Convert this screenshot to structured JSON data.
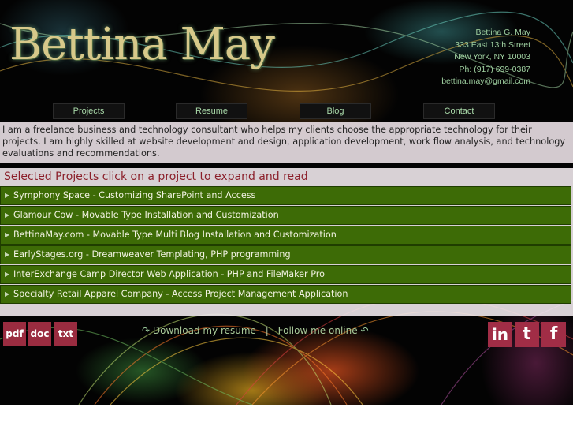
{
  "header": {
    "logo_text": "Bettina May",
    "contact": {
      "name": "Bettina G. May",
      "street": "333 East 13th Street",
      "city": "New York, NY 10003",
      "phone": "Ph: (917) 699-0387",
      "email": "bettina.may@gmail.com"
    }
  },
  "nav": {
    "items": [
      {
        "label": "Projects"
      },
      {
        "label": "Resume"
      },
      {
        "label": "Blog"
      },
      {
        "label": "Contact"
      }
    ]
  },
  "intro": {
    "text": "I am a freelance business and technology consultant who helps my clients choose the appropriate technology for their projects. I am highly skilled at website development and design, application development, work flow analysis, and technology evaluations and recommendations."
  },
  "projects": {
    "title": "Selected Projects click on a project to expand and read",
    "items": [
      {
        "label": "Symphony Space - Customizing SharePoint and Access"
      },
      {
        "label": "Glamour Cow - Movable Type Installation and Customization"
      },
      {
        "label": "BettinaMay.com - Movable Type Multi Blog Installation and Customization"
      },
      {
        "label": "EarlyStages.org - Dreamweaver Templating, PHP programming"
      },
      {
        "label": "InterExchange Camp Director Web Application - PHP and FileMaker Pro"
      },
      {
        "label": "Specialty Retail Apparel Company - Access Project Management Application"
      }
    ]
  },
  "footer": {
    "downloads": [
      {
        "label": "pdf",
        "icon": "pdf-icon"
      },
      {
        "label": "doc",
        "icon": "doc-icon"
      },
      {
        "label": "txt",
        "icon": "txt-icon"
      }
    ],
    "download_resume": "Download my resume",
    "separator": "|",
    "follow_me": "Follow me online",
    "social": [
      {
        "label": "in",
        "icon": "linkedin-icon"
      },
      {
        "label": "t",
        "icon": "twitter-icon"
      },
      {
        "label": "f",
        "icon": "facebook-icon"
      }
    ]
  },
  "colors": {
    "project_bar": "#3d6b06",
    "title_red": "#8b1f2a",
    "footer_button": "#9a2c40",
    "nav_text": "#a8d8a8"
  }
}
